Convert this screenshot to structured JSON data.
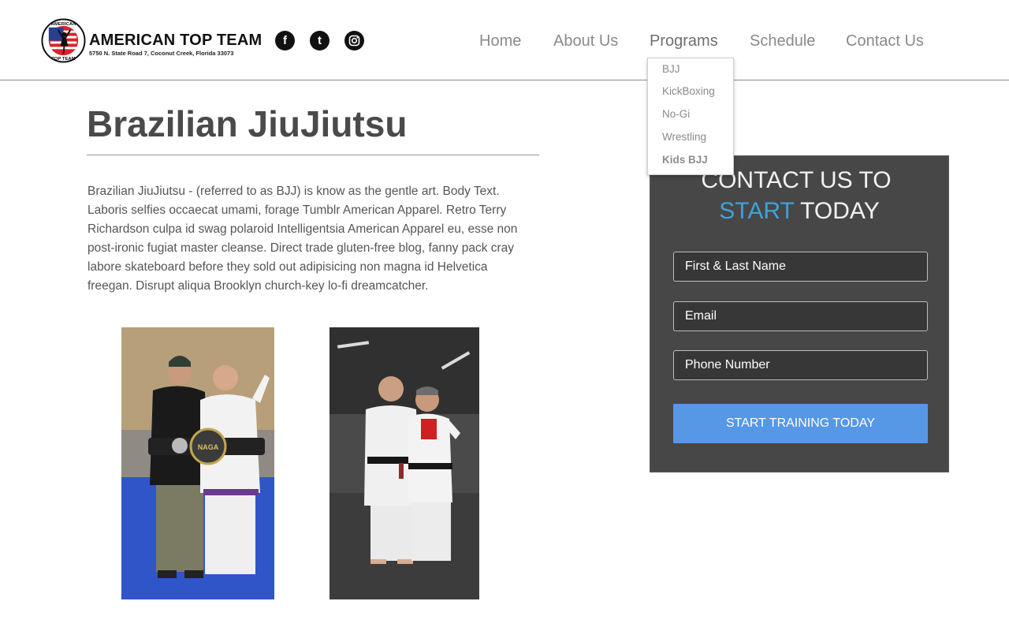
{
  "header": {
    "brand_name": "AMERICAN TOP TEAM",
    "brand_address": "5750 N. State Road 7, Coconut Creek, Florida 33073",
    "seal_text_top": "AMERICAN",
    "seal_text_bottom": "TOP TEAM",
    "social": [
      {
        "icon": "facebook-icon",
        "glyph": "f"
      },
      {
        "icon": "twitter-icon",
        "glyph": "t"
      },
      {
        "icon": "instagram-icon",
        "glyph": "◎"
      }
    ],
    "nav": [
      {
        "label": "Home"
      },
      {
        "label": "About Us"
      },
      {
        "label": "Programs",
        "active": true
      },
      {
        "label": "Schedule"
      },
      {
        "label": "Contact Us"
      }
    ],
    "programs_dropdown": [
      {
        "label": "BJJ"
      },
      {
        "label": "KickBoxing"
      },
      {
        "label": "No-Gi"
      },
      {
        "label": "Wrestling"
      },
      {
        "label": "Kids BJJ"
      }
    ]
  },
  "main": {
    "title": "Brazilian JiuJiutsu",
    "body": "Brazilian JiuJiutsu - (referred to as BJJ) is know as the gentle art. Body Text. Laboris selfies occaecat umami, forage Tumblr American Apparel. Retro Terry Richardson culpa id swag polaroid Intelligentsia American Apparel eu, esse non post-ironic fugiat master cleanse. Direct trade gluten-free blog, fanny pack cray labore skateboard before they sold out adipisicing non magna id Helvetica freegan. Disrupt aliqua Brooklyn church-key lo-fi dreamcatcher.",
    "photo1_belt_text": "NAGA"
  },
  "contact_form": {
    "heading_line1": "CONTACT US TO",
    "heading_start": "START",
    "heading_rest": " TODAY",
    "name_placeholder": "First & Last Name",
    "email_placeholder": "Email",
    "phone_placeholder": "Phone Number",
    "submit_label": "START TRAINING TODAY"
  },
  "colors": {
    "accent_blue": "#3fa2d8",
    "button_blue": "#5697e6",
    "panel_bg": "#474747"
  }
}
